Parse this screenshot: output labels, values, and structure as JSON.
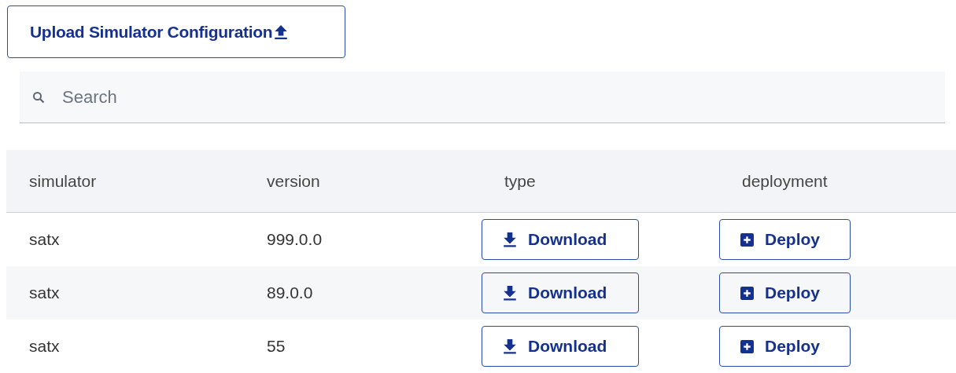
{
  "upload_button": {
    "label": "Upload Simulator Configuration"
  },
  "search": {
    "placeholder": "Search"
  },
  "table": {
    "columns": [
      "simulator",
      "version",
      "type",
      "deployment"
    ],
    "rows": [
      {
        "simulator": "satx",
        "version": "999.0.0",
        "download": "Download",
        "deploy": "Deploy"
      },
      {
        "simulator": "satx",
        "version": "89.0.0",
        "download": "Download",
        "deploy": "Deploy"
      },
      {
        "simulator": "satx",
        "version": "55",
        "download": "Download",
        "deploy": "Deploy"
      }
    ]
  }
}
